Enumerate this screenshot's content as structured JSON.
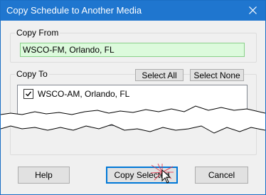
{
  "window": {
    "title": "Copy Schedule to Another Media"
  },
  "copy_from": {
    "label": "Copy From",
    "value": "WSCO-FM, Orlando, FL"
  },
  "copy_to": {
    "label": "Copy To",
    "select_all_label": "Select All",
    "select_none_label": "Select None",
    "items": [
      {
        "label": "WSCO-AM, Orlando, FL",
        "checked": true
      }
    ]
  },
  "footer": {
    "help_label": "Help",
    "copy_selected_label": "Copy Selected",
    "cancel_label": "Cancel"
  },
  "icons": {
    "close": "close-icon",
    "checkmark": "checkmark-icon",
    "cursor": "mouse-pointer-icon"
  },
  "colors": {
    "titlebar": "#1f76cf",
    "field_bg": "#dcfadc",
    "field_border": "#8ad08a",
    "focus": "#0078d7"
  }
}
